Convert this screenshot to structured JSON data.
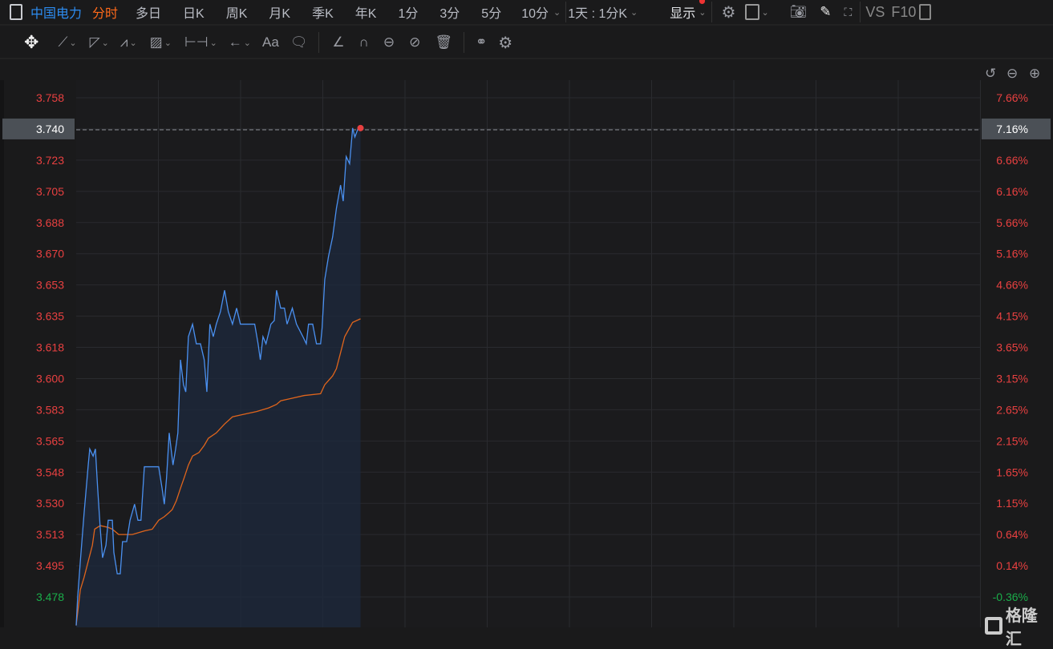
{
  "toolbar": {
    "stock_name": "中国电力",
    "periods": [
      "分时",
      "多日",
      "日K",
      "周K",
      "月K",
      "季K",
      "年K",
      "1分",
      "3分",
      "5分",
      "10分"
    ],
    "active_period": "分时",
    "range": "1天 : 1分K",
    "display": "显示",
    "vs": "VS",
    "f10": "F10",
    "text_tool": "Aa"
  },
  "logo": "格隆汇",
  "colors": {
    "price_line": "#4a90f0",
    "avg_line": "#e0651c",
    "up": "#e84040",
    "down": "#1aad4a",
    "accent": "#2d8cf0",
    "active": "#ff6a1a"
  },
  "chart_data": {
    "type": "line",
    "xlim": [
      0,
      240
    ],
    "ylim": [
      3.458,
      3.758
    ],
    "left_ticks": [
      "3.758",
      "3.740",
      "3.723",
      "3.705",
      "3.688",
      "3.670",
      "3.653",
      "3.635",
      "3.618",
      "3.600",
      "3.583",
      "3.565",
      "3.548",
      "3.530",
      "3.513",
      "3.495",
      "3.478"
    ],
    "right_ticks": [
      "7.66%",
      "7.16%",
      "6.66%",
      "6.16%",
      "5.66%",
      "5.16%",
      "4.66%",
      "4.15%",
      "3.65%",
      "3.15%",
      "2.65%",
      "2.15%",
      "1.65%",
      "1.15%",
      "0.64%",
      "0.14%",
      "-0.36%"
    ],
    "current_price": "3.740",
    "current_pct": "7.16%",
    "series": [
      {
        "name": "price",
        "points": [
          [
            0,
            3.462
          ],
          [
            0.4,
            3.478
          ],
          [
            1.1,
            3.498
          ],
          [
            2.1,
            3.525
          ],
          [
            3.2,
            3.552
          ],
          [
            3.6,
            3.561
          ],
          [
            4.5,
            3.557
          ],
          [
            5.1,
            3.561
          ],
          [
            5.7,
            3.539
          ],
          [
            6.4,
            3.516
          ],
          [
            7,
            3.5
          ],
          [
            7.9,
            3.507
          ],
          [
            8.5,
            3.521
          ],
          [
            9.6,
            3.521
          ],
          [
            10,
            3.503
          ],
          [
            10.9,
            3.491
          ],
          [
            11.7,
            3.491
          ],
          [
            12.3,
            3.509
          ],
          [
            13.4,
            3.509
          ],
          [
            14.3,
            3.521
          ],
          [
            15.5,
            3.53
          ],
          [
            16.4,
            3.521
          ],
          [
            17.2,
            3.521
          ],
          [
            18.1,
            3.551
          ],
          [
            21.9,
            3.551
          ],
          [
            22.8,
            3.539
          ],
          [
            23.4,
            3.53
          ],
          [
            24,
            3.545
          ],
          [
            24.7,
            3.57
          ],
          [
            25.7,
            3.552
          ],
          [
            26.4,
            3.561
          ],
          [
            27,
            3.57
          ],
          [
            27.7,
            3.611
          ],
          [
            28.5,
            3.597
          ],
          [
            29.1,
            3.593
          ],
          [
            29.8,
            3.624
          ],
          [
            30.9,
            3.631
          ],
          [
            31.9,
            3.62
          ],
          [
            33,
            3.62
          ],
          [
            34,
            3.611
          ],
          [
            34.7,
            3.593
          ],
          [
            35.5,
            3.631
          ],
          [
            36.4,
            3.624
          ],
          [
            37.2,
            3.631
          ],
          [
            38.3,
            3.638
          ],
          [
            39.4,
            3.65
          ],
          [
            40.4,
            3.638
          ],
          [
            41.5,
            3.631
          ],
          [
            42.6,
            3.64
          ],
          [
            43.6,
            3.631
          ],
          [
            45.7,
            3.631
          ],
          [
            47.4,
            3.631
          ],
          [
            48.3,
            3.62
          ],
          [
            48.9,
            3.611
          ],
          [
            49.6,
            3.624
          ],
          [
            50.4,
            3.62
          ],
          [
            51.7,
            3.631
          ],
          [
            52.6,
            3.633
          ],
          [
            53.2,
            3.65
          ],
          [
            54.3,
            3.64
          ],
          [
            55.3,
            3.64
          ],
          [
            56,
            3.631
          ],
          [
            57.4,
            3.64
          ],
          [
            58.5,
            3.631
          ],
          [
            60.2,
            3.624
          ],
          [
            61.1,
            3.62
          ],
          [
            61.7,
            3.631
          ],
          [
            62.8,
            3.631
          ],
          [
            63.8,
            3.62
          ],
          [
            64.9,
            3.62
          ],
          [
            65.3,
            3.629
          ],
          [
            66,
            3.656
          ],
          [
            67,
            3.669
          ],
          [
            68.1,
            3.68
          ],
          [
            69.1,
            3.696
          ],
          [
            70.2,
            3.709
          ],
          [
            70.9,
            3.7
          ],
          [
            71.7,
            3.725
          ],
          [
            72.6,
            3.721
          ],
          [
            73.4,
            3.741
          ],
          [
            74,
            3.736
          ],
          [
            74.9,
            3.741
          ],
          [
            75.5,
            3.741
          ]
        ]
      },
      {
        "name": "average",
        "points": [
          [
            0,
            3.462
          ],
          [
            1.1,
            3.482
          ],
          [
            2.1,
            3.489
          ],
          [
            3.2,
            3.498
          ],
          [
            4.3,
            3.507
          ],
          [
            4.9,
            3.516
          ],
          [
            6.4,
            3.518
          ],
          [
            8.5,
            3.517
          ],
          [
            9.6,
            3.516
          ],
          [
            11.3,
            3.513
          ],
          [
            14.9,
            3.513
          ],
          [
            18.1,
            3.515
          ],
          [
            20.2,
            3.516
          ],
          [
            21.9,
            3.521
          ],
          [
            23.4,
            3.523
          ],
          [
            24.5,
            3.525
          ],
          [
            25.5,
            3.527
          ],
          [
            26.6,
            3.532
          ],
          [
            27.7,
            3.539
          ],
          [
            28.7,
            3.545
          ],
          [
            29.8,
            3.552
          ],
          [
            30.9,
            3.557
          ],
          [
            32.6,
            3.559
          ],
          [
            34,
            3.563
          ],
          [
            35.1,
            3.567
          ],
          [
            37.2,
            3.57
          ],
          [
            39.4,
            3.575
          ],
          [
            41.5,
            3.579
          ],
          [
            43.6,
            3.58
          ],
          [
            47.9,
            3.582
          ],
          [
            51.1,
            3.584
          ],
          [
            53.2,
            3.586
          ],
          [
            54.3,
            3.588
          ],
          [
            56.4,
            3.589
          ],
          [
            60.6,
            3.591
          ],
          [
            64.9,
            3.592
          ],
          [
            66,
            3.597
          ],
          [
            68.1,
            3.602
          ],
          [
            69.1,
            3.606
          ],
          [
            70.2,
            3.615
          ],
          [
            71.3,
            3.624
          ],
          [
            73.4,
            3.632
          ],
          [
            75.5,
            3.634
          ]
        ]
      }
    ]
  }
}
